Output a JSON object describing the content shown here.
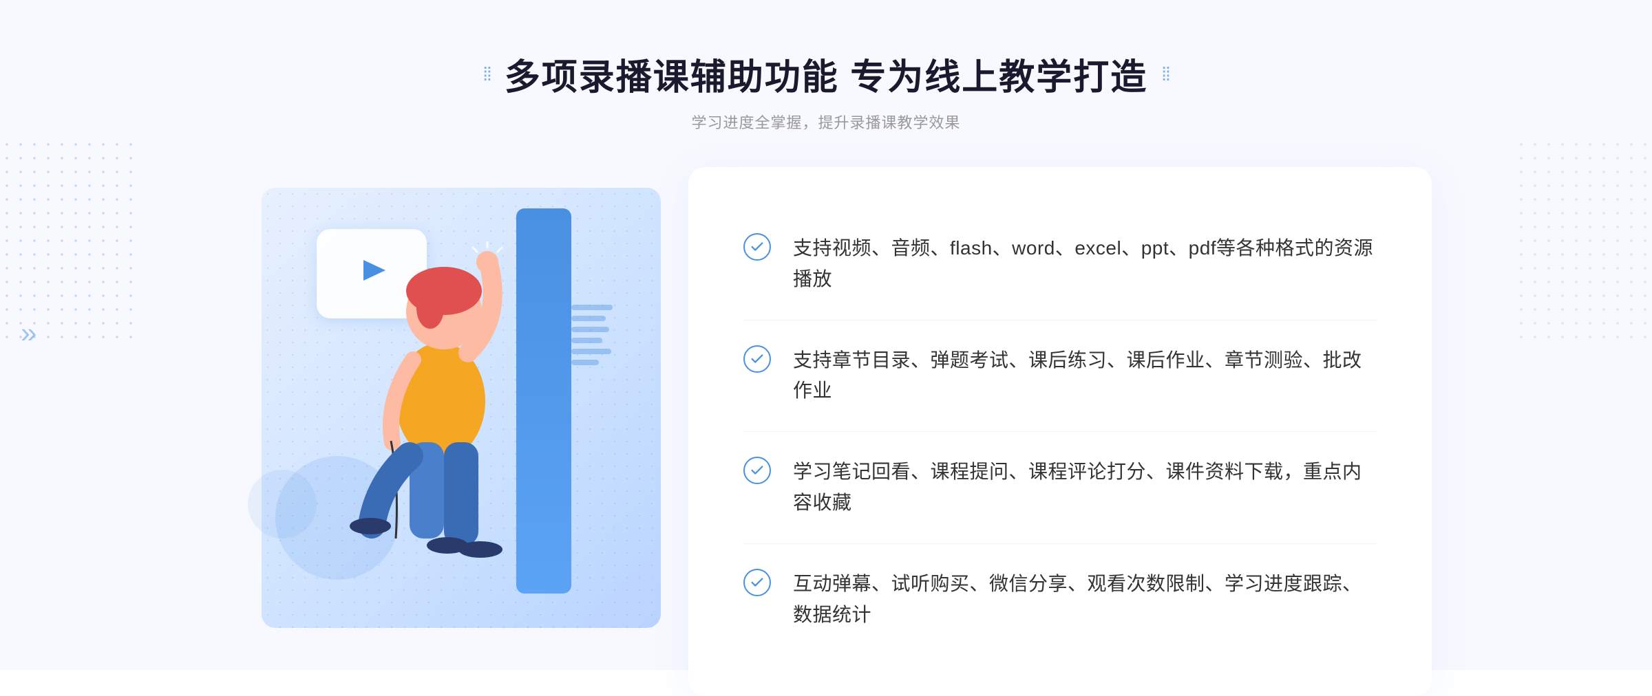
{
  "header": {
    "title": "多项录播课辅助功能 专为线上教学打造",
    "subtitle": "学习进度全掌握，提升录播课教学效果",
    "decorative_left": "⁞⁞",
    "decorative_right": "⁞⁞"
  },
  "features": [
    {
      "id": 1,
      "text": "支持视频、音频、flash、word、excel、ppt、pdf等各种格式的资源播放"
    },
    {
      "id": 2,
      "text": "支持章节目录、弹题考试、课后练习、课后作业、章节测验、批改作业"
    },
    {
      "id": 3,
      "text": "学习笔记回看、课程提问、课程评论打分、课件资料下载，重点内容收藏"
    },
    {
      "id": 4,
      "text": "互动弹幕、试听购买、微信分享、观看次数限制、学习进度跟踪、数据统计"
    }
  ],
  "colors": {
    "primary": "#4a90e2",
    "title": "#1a1a2e",
    "subtitle": "#999999",
    "feature_text": "#333333",
    "bg": "#f8f9ff"
  }
}
